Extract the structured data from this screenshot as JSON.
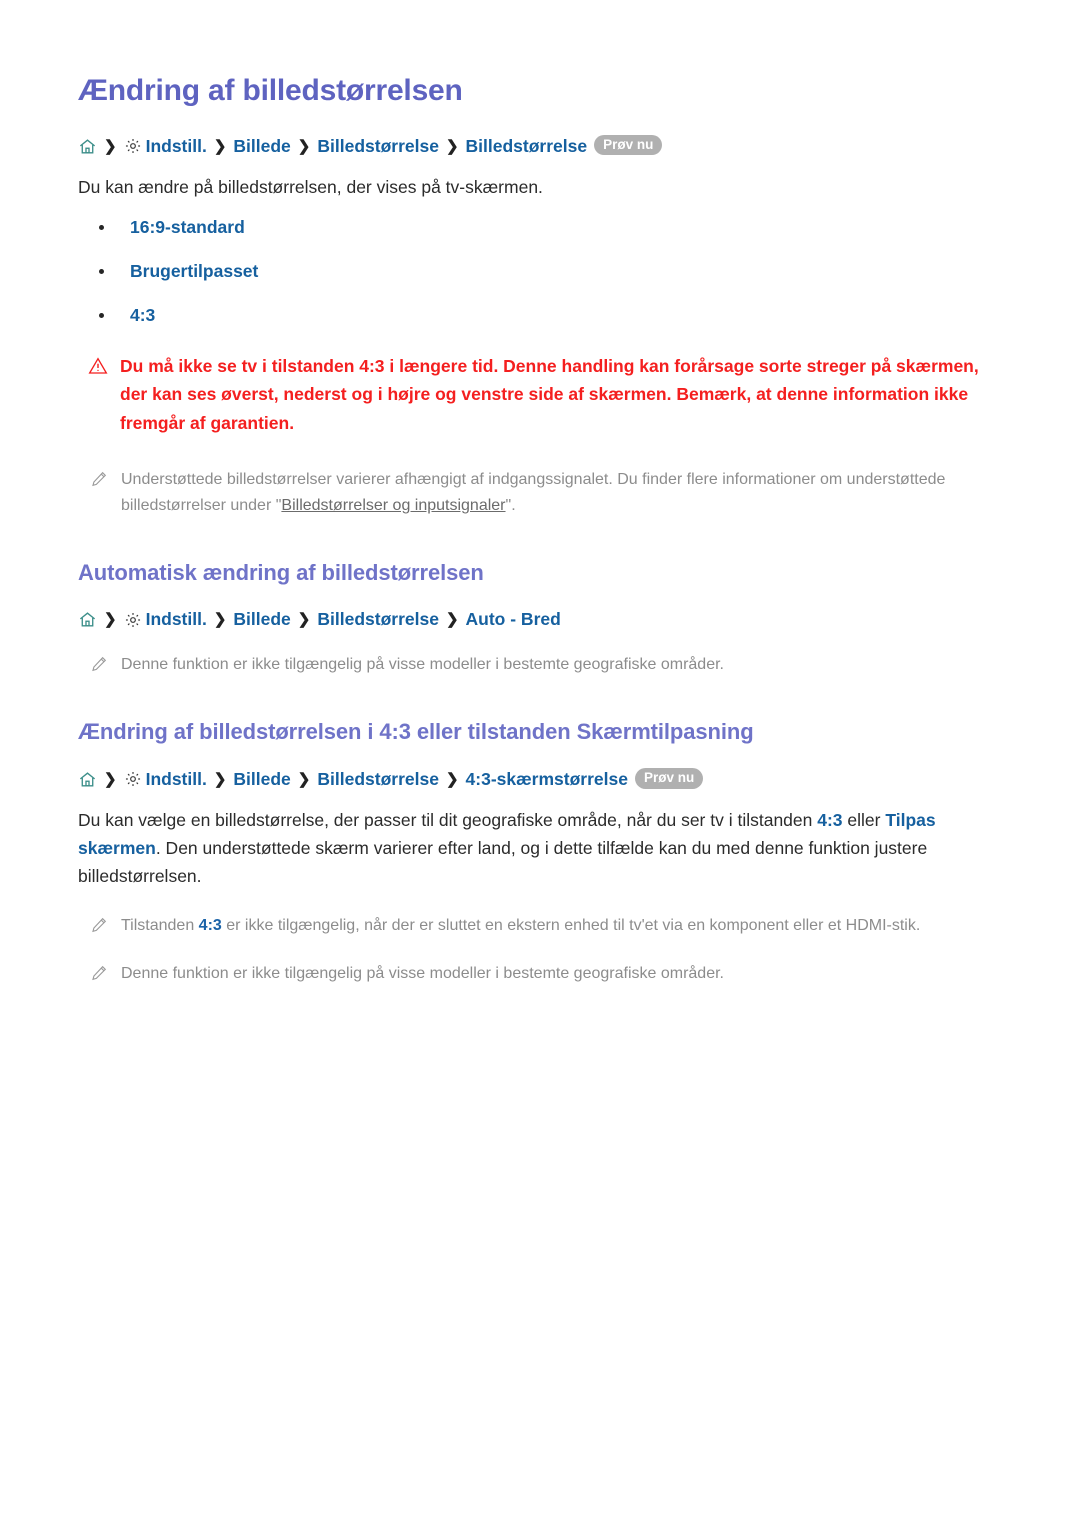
{
  "page": {
    "title": "Ændring af billedstørrelsen",
    "intro": "Du kan ændre på billedstørrelsen, der vises på tv-skærmen."
  },
  "icons": {
    "home": "home-icon",
    "gear": "gear-icon",
    "chevron": "chevron-right-icon",
    "warning": "warning-triangle-icon",
    "pencil": "pencil-icon"
  },
  "colors": {
    "heading": "#5e63c0",
    "subheading": "#6f73c8",
    "link": "#16609f",
    "warning": "#f41f1f",
    "note": "#8c8c8c",
    "badge": "#b0b0b0",
    "body": "#2b2b2b",
    "home_icon": "#3d8f8a"
  },
  "breadcrumb1": {
    "sep": "❯",
    "items": [
      "Indstill.",
      "Billede",
      "Billedstørrelse",
      "Billedstørrelse"
    ],
    "badge": "Prøv nu"
  },
  "bullets": [
    "16:9-standard",
    "Brugertilpasset",
    "4:3"
  ],
  "warning": {
    "text": "Du må ikke se tv i tilstanden 4:3 i længere tid. Denne handling kan forårsage sorte streger på skærmen, der kan ses øverst, nederst og i højre og venstre side af skærmen. Bemærk, at denne information ikke fremgår af garantien."
  },
  "note1": {
    "part1": "Understøttede billedstørrelser varierer afhængigt af indgangssignalet. Du finder flere informationer om understøttede billedstørrelser under \"",
    "link": "Billedstørrelser og inputsignaler",
    "part2": "\"."
  },
  "section2": {
    "title": "Automatisk ændring af billedstørrelsen",
    "breadcrumb": {
      "sep": "❯",
      "items": [
        "Indstill.",
        "Billede",
        "Billedstørrelse",
        "Auto - Bred"
      ]
    },
    "note": "Denne funktion er ikke tilgængelig på visse modeller i bestemte geografiske områder."
  },
  "section3": {
    "title": "Ændring af billedstørrelsen i 4:3 eller tilstanden Skærmtilpasning",
    "breadcrumb": {
      "sep": "❯",
      "items": [
        "Indstill.",
        "Billede",
        "Billedstørrelse",
        "4:3-skærmstørrelse"
      ],
      "badge": "Prøv nu"
    },
    "paragraph": {
      "part1": "Du kan vælge en billedstørrelse, der passer til dit geografiske område, når du ser tv i tilstanden ",
      "link1": "4:3",
      "part2": " eller ",
      "link2": "Tilpas skærmen",
      "part3": ". Den understøttede skærm varierer efter land, og i dette tilfælde kan du med denne funktion justere billedstørrelsen."
    },
    "note1": {
      "part1": "Tilstanden ",
      "link": "4:3",
      "part2": " er ikke tilgængelig, når der er sluttet en ekstern enhed til tv'et via en komponent eller et HDMI-stik."
    },
    "note2": "Denne funktion er ikke tilgængelig på visse modeller i bestemte geografiske områder."
  }
}
